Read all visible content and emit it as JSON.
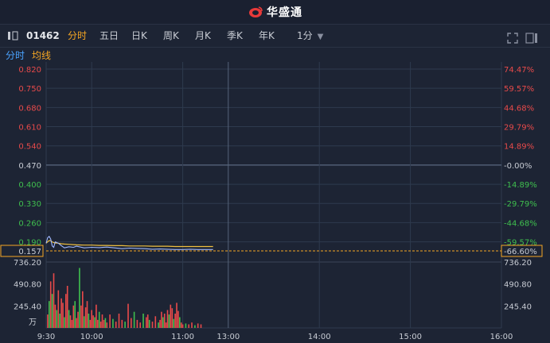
{
  "brand": {
    "name": "华盛通"
  },
  "toolbar": {
    "stock_code": "01462",
    "periods": [
      "分时",
      "五日",
      "日K",
      "周K",
      "月K",
      "季K",
      "年K"
    ],
    "active_period": "分时",
    "interval": "1分"
  },
  "subtabs": {
    "intraday": "分时",
    "avg_line": "均线"
  },
  "colors": {
    "bg": "#1d2434",
    "grid": "#2e3a4e",
    "up": "#e84a4a",
    "down": "#3fbf4e",
    "neutral": "#c8ccd4",
    "price_line": "#e8e8e8",
    "avg_line": "#f0c040",
    "accent": "#f5a623"
  },
  "chart_data": [
    {
      "type": "line",
      "name": "intraday-price",
      "price_ticks": [
        "0.820",
        "0.750",
        "0.680",
        "0.610",
        "0.540",
        "0.470",
        "0.400",
        "0.330",
        "0.260",
        "0.190"
      ],
      "pct_ticks": [
        "74.47%",
        "59.57%",
        "44.68%",
        "29.79%",
        "14.89%",
        "-0.00%",
        "-14.89%",
        "-29.79%",
        "-44.68%",
        "-59.57%"
      ],
      "prev_close": 0.47,
      "current_price": "0.157",
      "current_pct": "-66.60%",
      "ylim": [
        0.157,
        0.82
      ],
      "x_ticks": [
        "9:30",
        "10:00",
        "11:00",
        "13:00",
        "14:00",
        "15:00",
        "16:00"
      ],
      "x_minutes": [
        0,
        30,
        90,
        120,
        180,
        240,
        300
      ],
      "minutes": [
        0,
        1,
        2,
        3,
        4,
        5,
        6,
        8,
        10,
        12,
        15,
        18,
        20,
        25,
        30,
        35,
        40,
        45,
        50,
        55,
        60,
        65,
        70,
        75,
        80,
        85,
        90,
        95,
        100,
        105,
        110
      ],
      "price": [
        0.185,
        0.205,
        0.21,
        0.2,
        0.175,
        0.17,
        0.19,
        0.185,
        0.176,
        0.168,
        0.172,
        0.17,
        0.174,
        0.168,
        0.17,
        0.169,
        0.171,
        0.168,
        0.165,
        0.167,
        0.166,
        0.165,
        0.163,
        0.164,
        0.163,
        0.162,
        0.162,
        0.163,
        0.162,
        0.162,
        0.162
      ],
      "avg": [
        0.185,
        0.19,
        0.195,
        0.194,
        0.19,
        0.187,
        0.186,
        0.185,
        0.183,
        0.182,
        0.181,
        0.18,
        0.179,
        0.178,
        0.178,
        0.177,
        0.177,
        0.176,
        0.176,
        0.175,
        0.175,
        0.175,
        0.174,
        0.174,
        0.174,
        0.173,
        0.173,
        0.173,
        0.173,
        0.173,
        0.173
      ]
    },
    {
      "type": "bar",
      "name": "volume",
      "y_ticks": [
        "736.20",
        "490.80",
        "245.40"
      ],
      "unit": "万",
      "ylim": [
        0,
        736.2
      ],
      "bars": [
        {
          "m": 1,
          "v": 150,
          "d": "up"
        },
        {
          "m": 2,
          "v": 300,
          "d": "down"
        },
        {
          "m": 3,
          "v": 520,
          "d": "up"
        },
        {
          "m": 4,
          "v": 380,
          "d": "down"
        },
        {
          "m": 5,
          "v": 610,
          "d": "up"
        },
        {
          "m": 6,
          "v": 260,
          "d": "up"
        },
        {
          "m": 7,
          "v": 200,
          "d": "down"
        },
        {
          "m": 8,
          "v": 420,
          "d": "up"
        },
        {
          "m": 9,
          "v": 160,
          "d": "down"
        },
        {
          "m": 10,
          "v": 330,
          "d": "up"
        },
        {
          "m": 11,
          "v": 280,
          "d": "up"
        },
        {
          "m": 12,
          "v": 120,
          "d": "down"
        },
        {
          "m": 13,
          "v": 380,
          "d": "up"
        },
        {
          "m": 14,
          "v": 470,
          "d": "up"
        },
        {
          "m": 15,
          "v": 200,
          "d": "down"
        },
        {
          "m": 16,
          "v": 140,
          "d": "up"
        },
        {
          "m": 17,
          "v": 90,
          "d": "up"
        },
        {
          "m": 18,
          "v": 250,
          "d": "up"
        },
        {
          "m": 19,
          "v": 300,
          "d": "down"
        },
        {
          "m": 20,
          "v": 110,
          "d": "up"
        },
        {
          "m": 21,
          "v": 180,
          "d": "up"
        },
        {
          "m": 22,
          "v": 670,
          "d": "down"
        },
        {
          "m": 23,
          "v": 250,
          "d": "up"
        },
        {
          "m": 24,
          "v": 410,
          "d": "up"
        },
        {
          "m": 25,
          "v": 130,
          "d": "down"
        },
        {
          "m": 26,
          "v": 230,
          "d": "up"
        },
        {
          "m": 27,
          "v": 300,
          "d": "up"
        },
        {
          "m": 28,
          "v": 160,
          "d": "down"
        },
        {
          "m": 29,
          "v": 90,
          "d": "up"
        },
        {
          "m": 30,
          "v": 200,
          "d": "up"
        },
        {
          "m": 31,
          "v": 140,
          "d": "up"
        },
        {
          "m": 32,
          "v": 120,
          "d": "down"
        },
        {
          "m": 33,
          "v": 260,
          "d": "up"
        },
        {
          "m": 34,
          "v": 90,
          "d": "up"
        },
        {
          "m": 35,
          "v": 180,
          "d": "down"
        },
        {
          "m": 36,
          "v": 70,
          "d": "up"
        },
        {
          "m": 37,
          "v": 150,
          "d": "up"
        },
        {
          "m": 38,
          "v": 90,
          "d": "up"
        },
        {
          "m": 39,
          "v": 110,
          "d": "down"
        },
        {
          "m": 40,
          "v": 60,
          "d": "up"
        },
        {
          "m": 42,
          "v": 150,
          "d": "up"
        },
        {
          "m": 44,
          "v": 100,
          "d": "down"
        },
        {
          "m": 46,
          "v": 70,
          "d": "up"
        },
        {
          "m": 48,
          "v": 160,
          "d": "up"
        },
        {
          "m": 50,
          "v": 90,
          "d": "up"
        },
        {
          "m": 52,
          "v": 70,
          "d": "down"
        },
        {
          "m": 54,
          "v": 270,
          "d": "up"
        },
        {
          "m": 56,
          "v": 110,
          "d": "up"
        },
        {
          "m": 58,
          "v": 180,
          "d": "down"
        },
        {
          "m": 60,
          "v": 90,
          "d": "up"
        },
        {
          "m": 62,
          "v": 60,
          "d": "up"
        },
        {
          "m": 64,
          "v": 160,
          "d": "down"
        },
        {
          "m": 66,
          "v": 120,
          "d": "up"
        },
        {
          "m": 67,
          "v": 150,
          "d": "up"
        },
        {
          "m": 68,
          "v": 90,
          "d": "down"
        },
        {
          "m": 70,
          "v": 70,
          "d": "up"
        },
        {
          "m": 72,
          "v": 130,
          "d": "up"
        },
        {
          "m": 74,
          "v": 60,
          "d": "down"
        },
        {
          "m": 75,
          "v": 90,
          "d": "up"
        },
        {
          "m": 76,
          "v": 180,
          "d": "up"
        },
        {
          "m": 77,
          "v": 120,
          "d": "down"
        },
        {
          "m": 78,
          "v": 160,
          "d": "up"
        },
        {
          "m": 79,
          "v": 60,
          "d": "up"
        },
        {
          "m": 80,
          "v": 200,
          "d": "up"
        },
        {
          "m": 81,
          "v": 150,
          "d": "down"
        },
        {
          "m": 82,
          "v": 260,
          "d": "up"
        },
        {
          "m": 83,
          "v": 220,
          "d": "up"
        },
        {
          "m": 84,
          "v": 100,
          "d": "down"
        },
        {
          "m": 85,
          "v": 160,
          "d": "up"
        },
        {
          "m": 86,
          "v": 280,
          "d": "up"
        },
        {
          "m": 87,
          "v": 190,
          "d": "up"
        },
        {
          "m": 88,
          "v": 120,
          "d": "down"
        },
        {
          "m": 89,
          "v": 60,
          "d": "up"
        },
        {
          "m": 90,
          "v": 40,
          "d": "up"
        },
        {
          "m": 92,
          "v": 50,
          "d": "down"
        },
        {
          "m": 94,
          "v": 40,
          "d": "up"
        },
        {
          "m": 96,
          "v": 60,
          "d": "up"
        },
        {
          "m": 98,
          "v": 30,
          "d": "down"
        },
        {
          "m": 100,
          "v": 50,
          "d": "up"
        },
        {
          "m": 102,
          "v": 40,
          "d": "up"
        }
      ]
    }
  ]
}
